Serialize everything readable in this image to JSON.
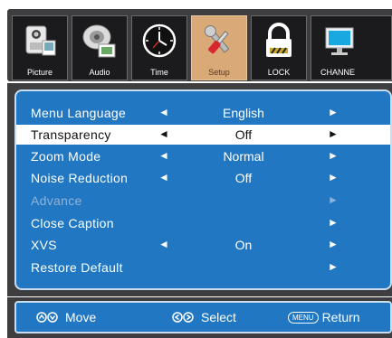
{
  "tabs": [
    {
      "label": "Picture",
      "icon": "picture-camera-icon",
      "active": false
    },
    {
      "label": "Audio",
      "icon": "audio-speaker-icon",
      "active": false
    },
    {
      "label": "Time",
      "icon": "clock-icon",
      "active": false
    },
    {
      "label": "Setup",
      "icon": "setup-tools-icon",
      "active": true
    },
    {
      "label": "LOCK",
      "icon": "lock-icon",
      "active": false
    },
    {
      "label": "CHANNE",
      "icon": "channel-monitor-icon",
      "active": false
    }
  ],
  "menu": {
    "items": [
      {
        "label": "Menu Language",
        "value": "English",
        "left_arrow": "◄",
        "right_arrow": "►",
        "selected": false,
        "disabled": false
      },
      {
        "label": "Transparency",
        "value": "Off",
        "left_arrow": "◄",
        "right_arrow": "►",
        "selected": true,
        "disabled": false
      },
      {
        "label": "Zoom Mode",
        "value": "Normal",
        "left_arrow": "◄",
        "right_arrow": "►",
        "selected": false,
        "disabled": false
      },
      {
        "label": "Noise Reduction",
        "value": "Off",
        "left_arrow": "◄",
        "right_arrow": "►",
        "selected": false,
        "disabled": false
      },
      {
        "label": "Advance",
        "value": "",
        "left_arrow": "",
        "right_arrow": "►",
        "selected": false,
        "disabled": true
      },
      {
        "label": "Close Caption",
        "value": "",
        "left_arrow": "",
        "right_arrow": "►",
        "selected": false,
        "disabled": false
      },
      {
        "label": "XVS",
        "value": "On",
        "left_arrow": "◄",
        "right_arrow": "►",
        "selected": false,
        "disabled": false
      },
      {
        "label": "Restore Default",
        "value": "",
        "left_arrow": "",
        "right_arrow": "►",
        "selected": false,
        "disabled": false
      }
    ]
  },
  "help": {
    "move_label": "Move",
    "select_label": "Select",
    "menu_key": "MENU",
    "return_label": "Return"
  },
  "colors": {
    "panel_blue": "#2177c2",
    "frame_gray": "#3e3e40",
    "active_tab": "#d9a977"
  }
}
